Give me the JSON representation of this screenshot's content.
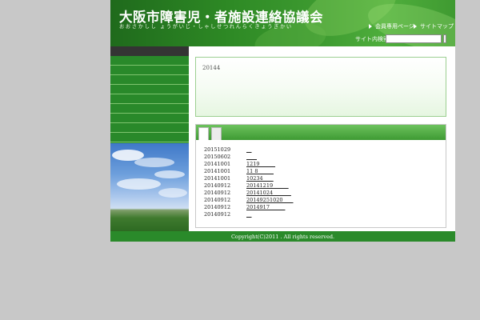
{
  "header": {
    "title": "大阪市障害児・者施設連絡協議会",
    "reading": "おおさかしし ょうがいじ・しゃしせつれんらくきょうぎかい",
    "members_link": "会員専用ページ",
    "sitemap_link": "サイトマップ",
    "search_label": "サイト内検索",
    "search_value": ""
  },
  "sidebar": {
    "items": [
      "",
      "",
      "",
      "",
      "",
      "",
      "",
      "",
      ""
    ]
  },
  "notice": {
    "text": "20144"
  },
  "news": {
    "rows": [
      {
        "date": "20151029",
        "title": "__"
      },
      {
        "date": "20150602",
        "title": "____"
      },
      {
        "date": "20141001",
        "title": "1219______"
      },
      {
        "date": "20141001",
        "title": "11 8______"
      },
      {
        "date": "20141001",
        "title": "10234____"
      },
      {
        "date": "20140912",
        "title": "20141219______"
      },
      {
        "date": "20140912",
        "title": "20141024_______"
      },
      {
        "date": "20140912",
        "title": "20149251020____"
      },
      {
        "date": "20140912",
        "title": "2014917______"
      },
      {
        "date": "20140912",
        "title": "__"
      }
    ]
  },
  "footer": {
    "copyright": "Copyright(C)2011 . All rights reserved."
  }
}
